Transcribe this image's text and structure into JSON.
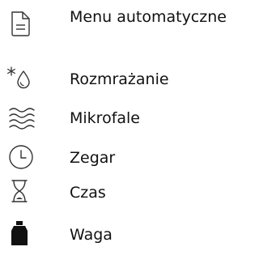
{
  "menu": {
    "items": [
      {
        "label": "Menu automatyczne",
        "icon": "document-icon"
      },
      {
        "label": "Rozmrażanie",
        "icon": "snowflake-drop-icon"
      },
      {
        "label": "Mikrofale",
        "icon": "microwave-waves-icon"
      },
      {
        "label": "Zegar",
        "icon": "clock-icon"
      },
      {
        "label": "Czas",
        "icon": "hourglass-icon"
      },
      {
        "label": "Waga",
        "icon": "weight-icon"
      }
    ]
  }
}
